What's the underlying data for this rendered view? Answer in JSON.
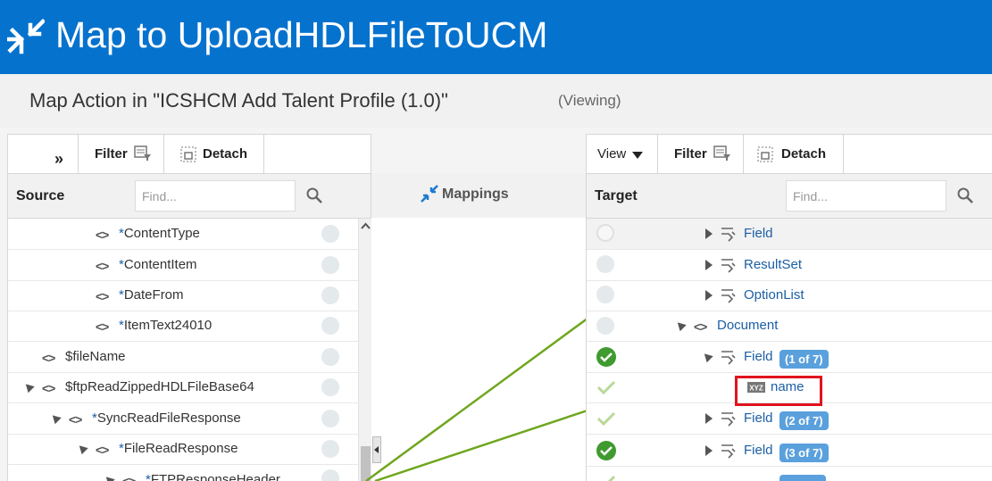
{
  "header": {
    "title": "Map to UploadHDLFileToUCM",
    "icon": "map-arrows-icon"
  },
  "subheader": {
    "title": "Map Action in \"ICSHCM Add Talent Profile (1.0)\"",
    "mode": "(Viewing)"
  },
  "source": {
    "toolbar": {
      "expand": "»",
      "filter": "Filter",
      "detach": "Detach"
    },
    "heading": "Source",
    "find_placeholder": "Find...",
    "rows": [
      {
        "star": "*",
        "label": "ContentType"
      },
      {
        "star": "*",
        "label": "ContentItem"
      },
      {
        "star": "*",
        "label": "DateFrom"
      },
      {
        "star": "*",
        "label": "ItemText24010"
      },
      {
        "star": "",
        "label": "$fileName"
      },
      {
        "star": "",
        "label": "$ftpReadZippedHDLFileBase64"
      },
      {
        "star": "*",
        "label": "SyncReadFileResponse"
      },
      {
        "star": "*",
        "label": "FileReadResponse"
      },
      {
        "star": "*",
        "label": "FTPResponseHeader"
      }
    ]
  },
  "mappings": {
    "label": "Mappings"
  },
  "target": {
    "toolbar": {
      "view": "View",
      "filter": "Filter",
      "detach": "Detach"
    },
    "heading": "Target",
    "find_placeholder": "Find...",
    "rows": [
      {
        "label": "Field",
        "badge": ""
      },
      {
        "label": "ResultSet",
        "badge": ""
      },
      {
        "label": "OptionList",
        "badge": ""
      },
      {
        "label": "Document",
        "badge": ""
      },
      {
        "label": "Field",
        "badge": "(1 of 7)"
      },
      {
        "label": "name",
        "badge": ""
      },
      {
        "label": "Field",
        "badge": "(2 of 7)"
      },
      {
        "label": "Field",
        "badge": "(3 of 7)"
      }
    ]
  },
  "colors": {
    "header_bg": "#0572ce",
    "link": "#1b5fa5",
    "badge": "#5aa0dd",
    "mapping_line": "#6fa61e",
    "mapped_check": "#3f9a2f",
    "highlight": "#e0141e"
  }
}
